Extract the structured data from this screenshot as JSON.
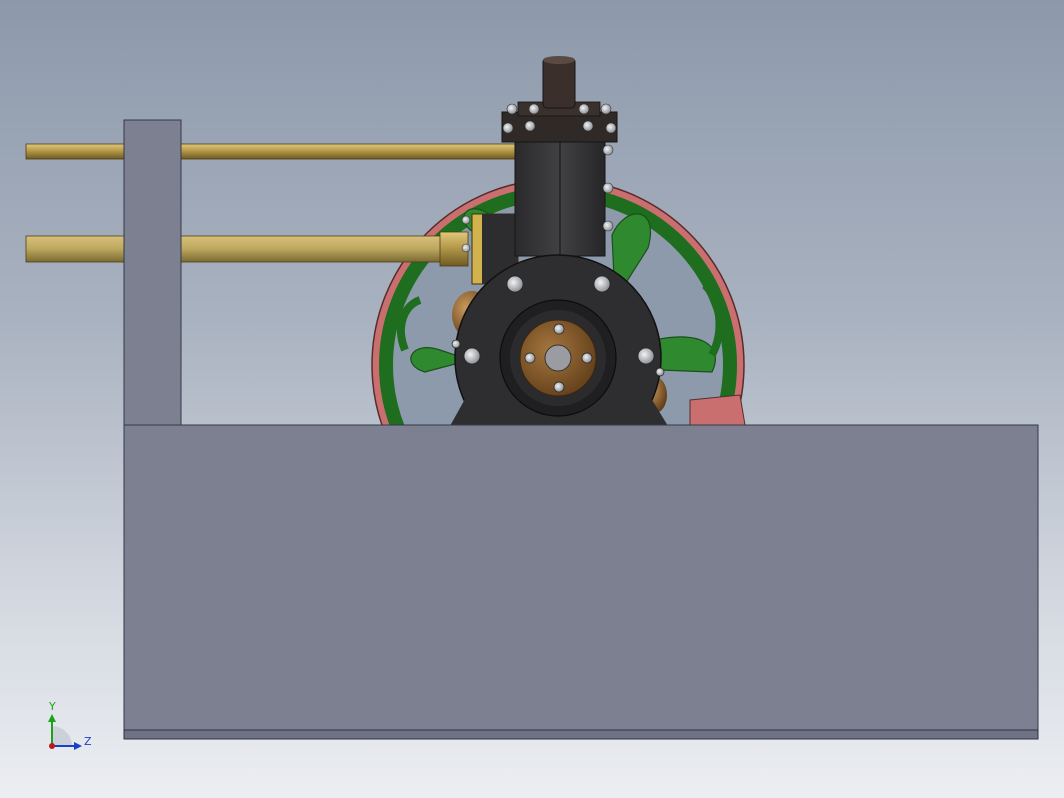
{
  "view": {
    "background_top": "#8d99ab",
    "background_bottom": "#eceef2"
  },
  "colors": {
    "base_block": "#7d8091",
    "base_edge": "#3a3d48",
    "flywheel_rim": "#cd7575",
    "flywheel_spokes": "#2e8b2e",
    "cylinder": "#3b3b3d",
    "brass_rod": "#b59a4a",
    "bronze": "#8a5a2b",
    "bolt": "#bfc3c8"
  },
  "triad": {
    "y_label": "Y",
    "z_label": "Z",
    "y_color": "#1aa31a",
    "z_color": "#1a3fc9",
    "origin_color": "#c0141e",
    "icon": "coordinate-triad-icon"
  }
}
